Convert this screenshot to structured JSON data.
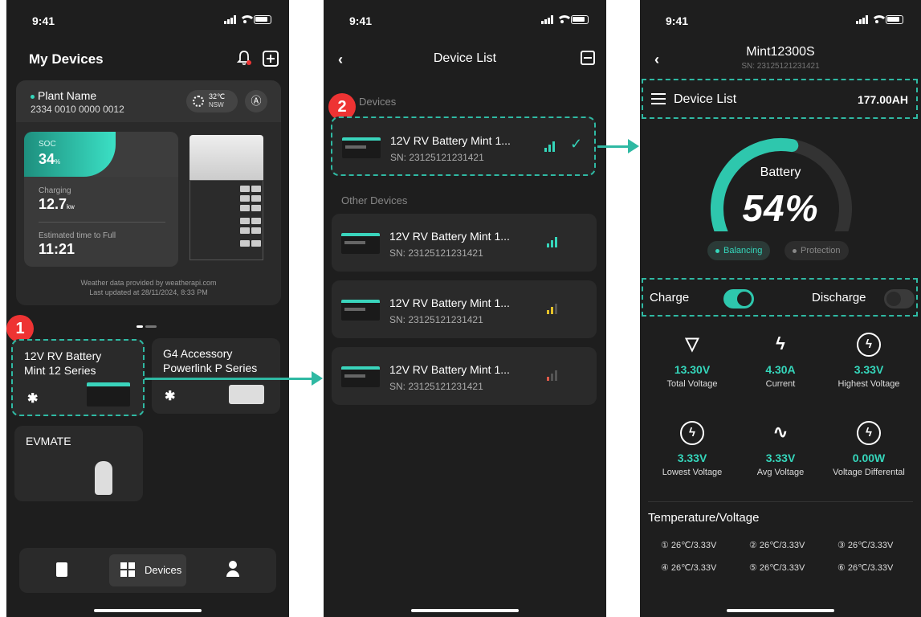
{
  "status": {
    "time": "9:41"
  },
  "screen1": {
    "title": "My Devices",
    "plant": {
      "name": "Plant Name",
      "id": "2334 0010 0000 0012",
      "weather_temp": "32℃",
      "weather_region": "NSW",
      "nav_glyph": "Ⓐ",
      "soc_label": "SOC",
      "soc_value": "34",
      "soc_unit": "%",
      "soc_fraction": 0.34,
      "charging_label": "Charging",
      "charging_value": "12.7",
      "charging_unit": "kw",
      "eta_label": "Estimated time to Full",
      "eta_value": "11:21",
      "note_line1": "Weather data provided by weatherapi.com",
      "note_line2": "Last updated at 28/11/2024, 8:33 PM"
    },
    "step_badge": "1",
    "devices": [
      {
        "line1": "12V RV Battery",
        "line2": "Mint 12 Series"
      },
      {
        "line1": "G4 Accessory",
        "line2": "Powerlink P Series"
      },
      {
        "line1": "EVMATE",
        "line2": ""
      }
    ],
    "bt_glyph": "✱",
    "tabbar": {
      "devices_label": "Devices"
    }
  },
  "screen2": {
    "title": "Device List",
    "back_glyph": "‹",
    "step_badge": "2",
    "my_devices_label": "Devices",
    "other_devices_label": "Other Devices",
    "check_glyph": "✓",
    "selected": {
      "name": "12V RV Battery  Mint 1...",
      "sn": "SN: 23125121231421"
    },
    "others": [
      {
        "name": "12V RV Battery  Mint 1...",
        "sn": "SN: 23125121231421",
        "signal_color": "#35d6bb"
      },
      {
        "name": "12V RV Battery  Mint 1...",
        "sn": "SN: 23125121231421",
        "signal_color": "#e6c229"
      },
      {
        "name": "12V RV Battery  Mint 1...",
        "sn": "SN: 23125121231421",
        "signal_color": "#e05a4a"
      }
    ]
  },
  "screen3": {
    "title": "Mint12300S",
    "sn": "SN: 23125121231421",
    "back_glyph": "‹",
    "device_list_label": "Device List",
    "capacity": "177.00AH",
    "gauge_label": "Battery",
    "gauge_value": "54%",
    "gauge_fraction": 0.54,
    "pill_balancing": "Balancing",
    "pill_protection": "Protection",
    "charge_label": "Charge",
    "charge_on": true,
    "discharge_label": "Discharge",
    "discharge_on": false,
    "metrics": [
      {
        "icon": "triangle-icon",
        "glyph": "▽",
        "value": "13.30V",
        "label": "Total Voltage"
      },
      {
        "icon": "bolt-icon",
        "glyph": "ϟ",
        "value": "4.30A",
        "label": "Current"
      },
      {
        "icon": "bolt-plus-icon",
        "glyph": "ϟ",
        "value": "3.33V",
        "label": "Highest Voltage"
      },
      {
        "icon": "bolt-minus-icon",
        "glyph": "ϟ",
        "value": "3.33V",
        "label": "Lowest Voltage"
      },
      {
        "icon": "wave-icon",
        "glyph": "∿",
        "value": "3.33V",
        "label": "Avg Voltage"
      },
      {
        "icon": "bolt-circle-icon",
        "glyph": "ϟ",
        "value": "0.00W",
        "label": "Voltage Differental"
      }
    ],
    "temp_title": "Temperature/Voltage",
    "temps": [
      "① 26℃/3.33V",
      "② 26℃/3.33V",
      "③ 26℃/3.33V",
      "④ 26℃/3.33V",
      "⑤ 26℃/3.33V",
      "⑥ 26℃/3.33V"
    ]
  },
  "colors": {
    "accent": "#35d6bb",
    "dash": "#2fb9a3",
    "badge": "#e33333"
  }
}
